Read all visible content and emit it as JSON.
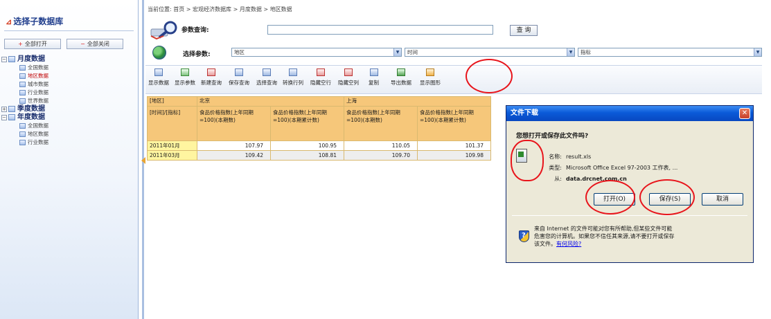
{
  "sidebar": {
    "title": "选择子数据库",
    "open_all_label": "全部打开",
    "close_all_label": "全部关闭",
    "tree": [
      {
        "label": "月度数据",
        "toggle": "−",
        "children": [
          {
            "label": "全国数据",
            "selected": false
          },
          {
            "label": "地区数据",
            "selected": true
          },
          {
            "label": "城市数据",
            "selected": false
          },
          {
            "label": "行业数据",
            "selected": false
          },
          {
            "label": "世界数据",
            "selected": false
          }
        ]
      },
      {
        "label": "季度数据",
        "toggle": "+",
        "children": []
      },
      {
        "label": "年度数据",
        "toggle": "−",
        "children": [
          {
            "label": "全国数据",
            "selected": false
          },
          {
            "label": "地区数据",
            "selected": false
          },
          {
            "label": "行业数据",
            "selected": false
          }
        ]
      }
    ]
  },
  "breadcrumb": "当前位置: 首页 > 宏观经济数据库 > 月度数据 > 地区数据",
  "query": {
    "label": "参数查询:",
    "input_value": "",
    "button_label": "查 询"
  },
  "selectors": {
    "label": "选择参数:",
    "region": "地区",
    "time": "时间",
    "index": "指标"
  },
  "toolbar": {
    "buttons": [
      {
        "id": "show-data",
        "label": "显示数据",
        "icon": "table-icon",
        "style": ""
      },
      {
        "id": "show-params",
        "label": "显示参数",
        "icon": "params-icon",
        "style": "green"
      },
      {
        "id": "new-query",
        "label": "新建查询",
        "icon": "new-query-icon",
        "style": "red"
      },
      {
        "id": "save-query",
        "label": "保存查询",
        "icon": "save-icon",
        "style": ""
      },
      {
        "id": "select-query",
        "label": "选择查询",
        "icon": "select-query-icon",
        "style": ""
      },
      {
        "id": "transpose",
        "label": "转换行列",
        "icon": "transpose-icon",
        "style": ""
      },
      {
        "id": "hide-empty-rows",
        "label": "隐藏空行",
        "icon": "hide-rows-icon",
        "style": "red"
      },
      {
        "id": "hide-empty-cols",
        "label": "隐藏空列",
        "icon": "hide-cols-icon",
        "style": "red"
      },
      {
        "id": "copy",
        "label": "复制",
        "icon": "copy-icon",
        "style": ""
      },
      {
        "id": "export-data",
        "label": "导出数据",
        "icon": "excel-export-icon",
        "style": "excel"
      },
      {
        "id": "show-chart",
        "label": "显示图形",
        "icon": "chart-icon",
        "style": "chart"
      }
    ]
  },
  "table": {
    "corner_top": "[地区]",
    "corner_bottom": "[时间]/[指标]",
    "regions": [
      "北京",
      "上海"
    ],
    "indicators": [
      "食品价格指数(上年同期=100)(本期数)",
      "食品价格指数(上年同期=100)(本期累计数)",
      "食品价格指数(上年同期=100)(本期数)",
      "食品价格指数(上年同期=100)(本期累计数)"
    ],
    "rows": [
      {
        "period": "2011年01月",
        "values": [
          "107.97",
          "100.95",
          "110.05",
          "101.37"
        ]
      },
      {
        "period": "2011年03月",
        "values": [
          "109.42",
          "108.81",
          "109.70",
          "109.98"
        ]
      }
    ]
  },
  "dialog": {
    "title": "文件下载",
    "close_glyph": "✕",
    "question": "您想打开或保存此文件吗?",
    "name_key": "名称:",
    "name_value": "result.xls",
    "type_key": "类型:",
    "type_value": "Microsoft Office Excel 97-2003 工作表, ...",
    "from_key": "从:",
    "from_value": "data.drcnet.com.cn",
    "open_label": "打开(O)",
    "save_label": "保存(S)",
    "cancel_label": "取消",
    "warning_line1": "来自 Internet 的文件可能对您有所帮助,但某些文件可能",
    "warning_line2": "危害您的计算机。如果您不信任其来源,请不要打开或保存",
    "warning_line3": "该文件。",
    "risk_link": "有何风险?"
  },
  "colors": {
    "annotation": "#e8141b",
    "table_header": "#f6c77a",
    "row_header": "#fff5a0",
    "dialog_title": "#0a5ad8"
  }
}
